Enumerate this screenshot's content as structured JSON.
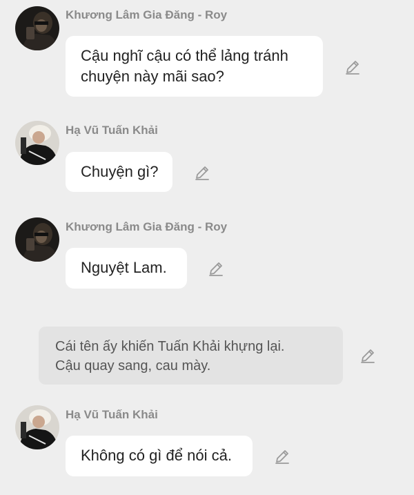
{
  "messages": [
    {
      "type": "chat",
      "sender": "Khương Lâm Gia Đăng - Roy",
      "avatar": "avatar-roy",
      "lines": [
        "Cậu nghĩ cậu có thể lảng tránh",
        "chuyện này mãi sao?"
      ],
      "icon": "pencil-edit-icon"
    },
    {
      "type": "chat",
      "sender": "Hạ Vũ Tuấn Khải",
      "avatar": "avatar-tuan-khai",
      "lines": [
        "Chuyện gì?"
      ],
      "icon": "pencil-edit-icon"
    },
    {
      "type": "chat",
      "sender": "Khương Lâm Gia Đăng - Roy",
      "avatar": "avatar-roy",
      "lines": [
        "Nguyệt Lam."
      ],
      "icon": "pencil-edit-icon"
    },
    {
      "type": "narration",
      "lines": [
        "Cái tên ấy khiến Tuấn Khải khựng lại.",
        "Cậu quay sang, cau mày."
      ],
      "icon": "pencil-edit-icon"
    },
    {
      "type": "chat",
      "sender": "Hạ Vũ Tuấn Khải",
      "avatar": "avatar-tuan-khai",
      "lines": [
        "Không có gì để nói cả."
      ],
      "icon": "pencil-edit-icon"
    }
  ],
  "colors": {
    "background": "#eeeeee",
    "bubble": "#ffffff",
    "narration_bubble": "#e3e3e3",
    "sender_text": "#8a8a8a",
    "icon": "#9a9a9a"
  }
}
